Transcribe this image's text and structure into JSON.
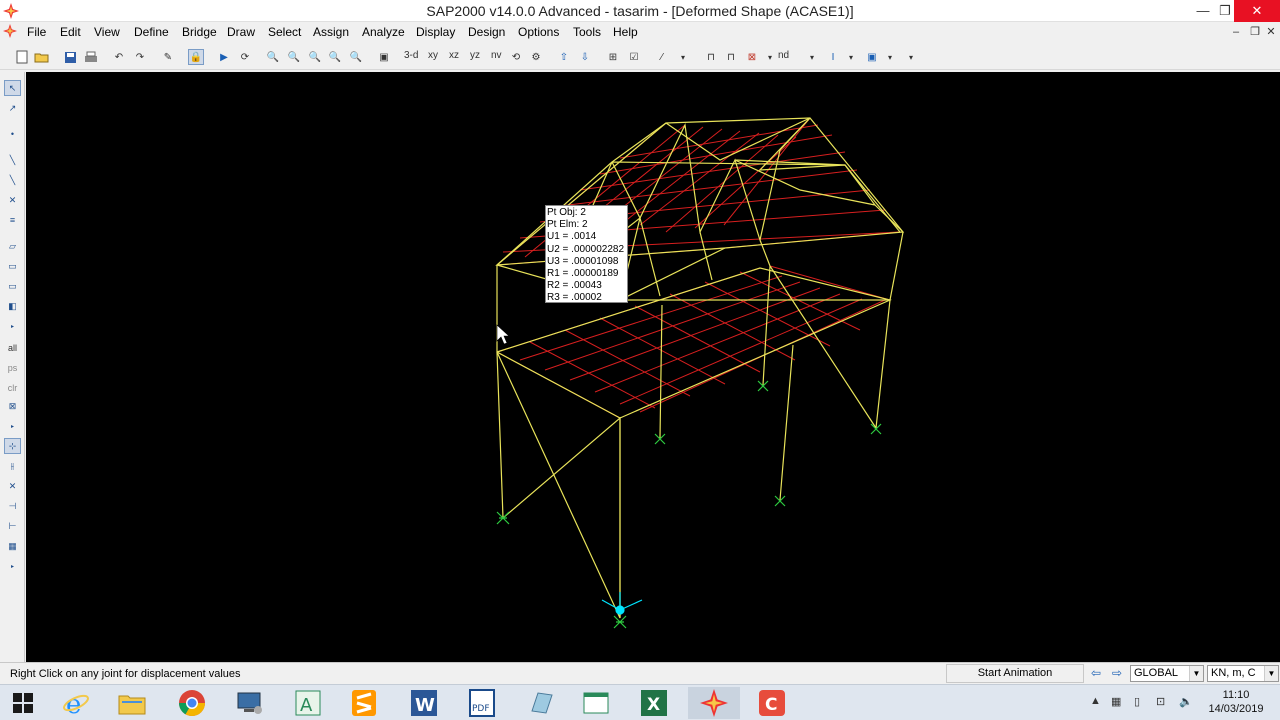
{
  "window": {
    "title": "SAP2000 v14.0.0 Advanced  - tasarim - [Deformed Shape (ACASE1)]",
    "minimize": "—",
    "restore": "❐",
    "close": "✕",
    "mdi_min": "–",
    "mdi_restore": "❐",
    "mdi_close": "✕"
  },
  "menu": [
    "File",
    "Edit",
    "View",
    "Define",
    "Bridge",
    "Draw",
    "Select",
    "Assign",
    "Analyze",
    "Display",
    "Design",
    "Options",
    "Tools",
    "Help"
  ],
  "toolbar": {
    "view_3d": "3-d",
    "view_xy": "xy",
    "view_xz": "xz",
    "view_yz": "yz",
    "view_nv": "nv",
    "nd": "nd"
  },
  "lefttoolbar": {
    "all": "all",
    "ps": "ps",
    "clr": "clr"
  },
  "tooltip": {
    "lines": [
      "Pt Obj: 2",
      "Pt Elm: 2",
      "U1 = .0014",
      "U2 = .000002282",
      "U3 = .00001098",
      "R1 = .00000189",
      "R2 = .00043",
      "R3 = .00002"
    ]
  },
  "status": {
    "message": "Right Click on any joint for displacement values",
    "animation": "Start Animation",
    "coord_system": "GLOBAL",
    "units": "KN, m, C"
  },
  "taskbar": {
    "time": "11:10",
    "date": "14/03/2019"
  },
  "colors": {
    "frame": "#e8e35a",
    "shell_grid": "#d61f1f",
    "support": "#2ecc40",
    "axes": "#00e5ff",
    "close": "#e81123"
  }
}
